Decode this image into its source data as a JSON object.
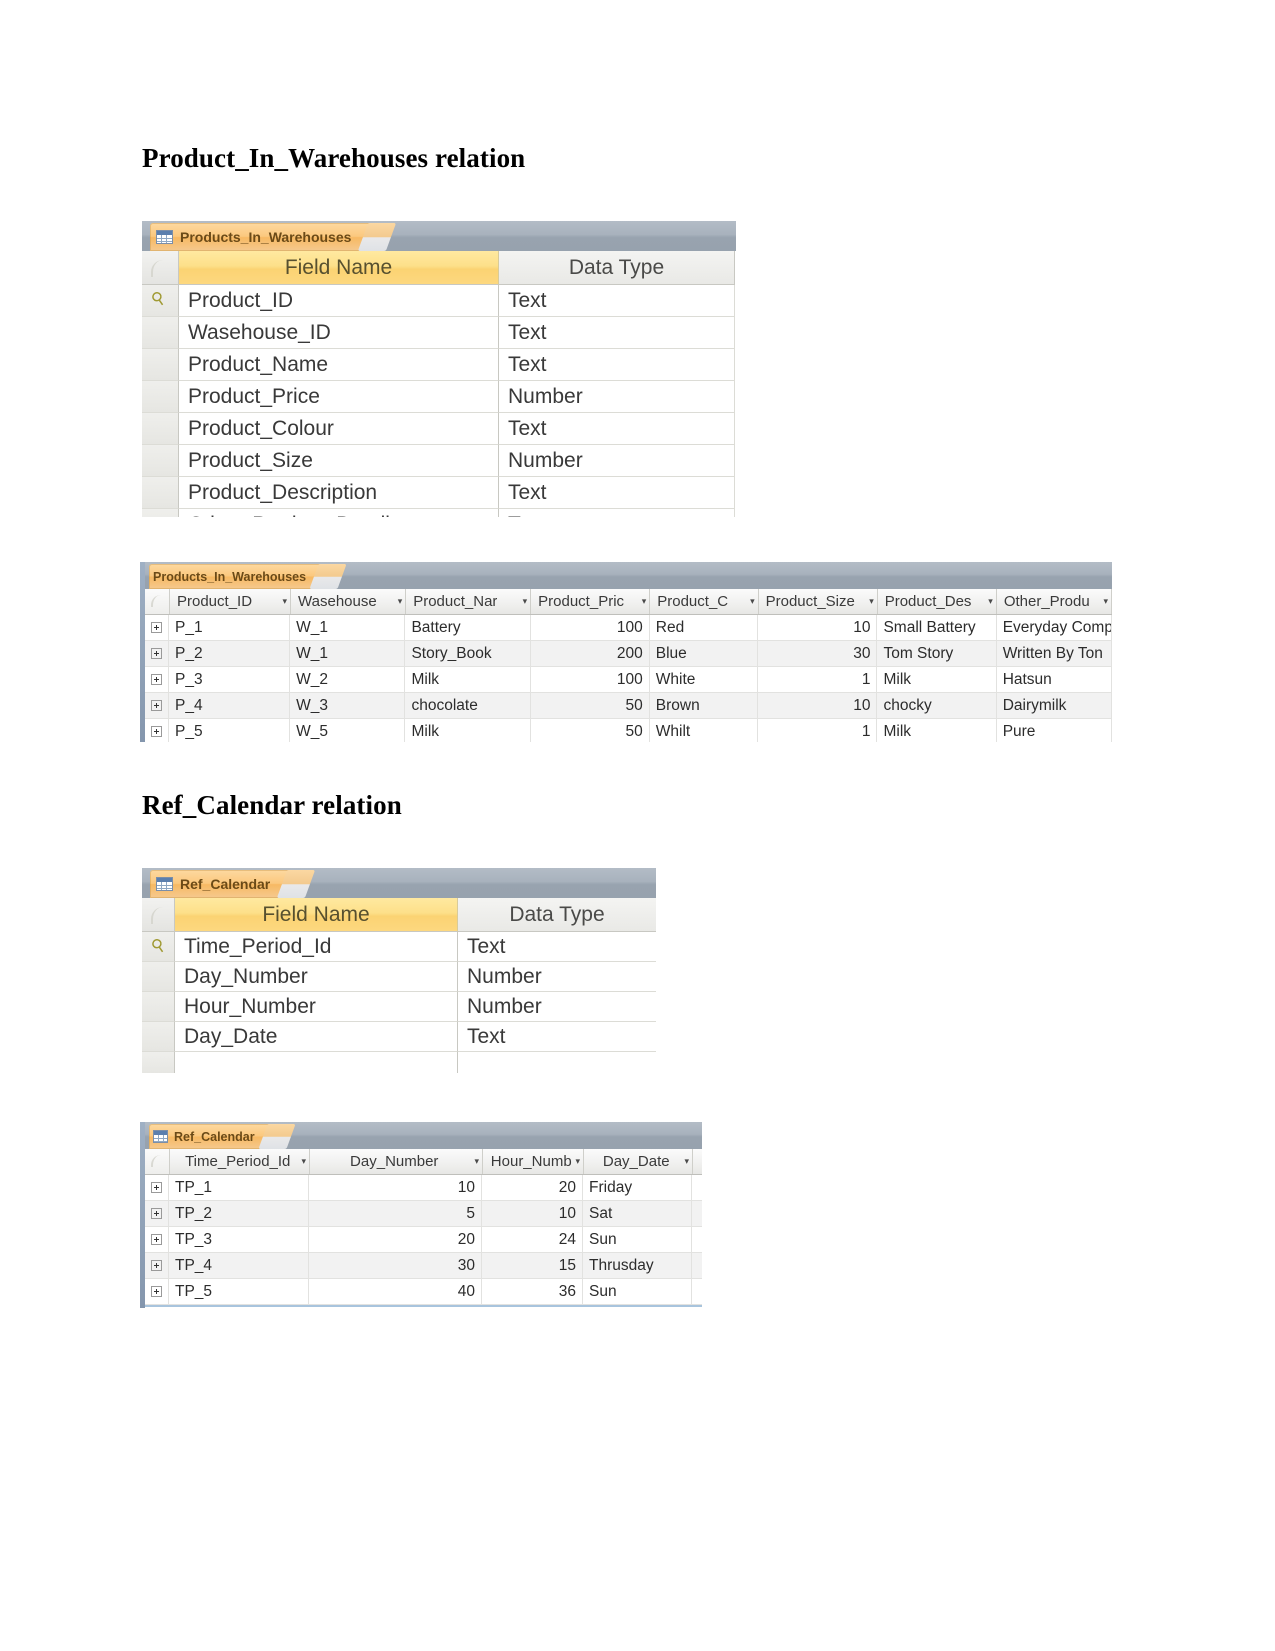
{
  "document": {
    "headings": [
      {
        "id": "products-heading",
        "text": "Product_In_Warehouses relation"
      },
      {
        "id": "calendar-heading",
        "text": "Ref_Calendar relation"
      }
    ]
  },
  "products_design": {
    "tab_label": "Products_In_Warehouses",
    "columns": {
      "field_name": "Field Name",
      "data_type": "Data Type"
    },
    "rows": [
      {
        "primary_key": true,
        "field": "Product_ID",
        "type": "Text"
      },
      {
        "primary_key": false,
        "field": "Wasehouse_ID",
        "type": "Text"
      },
      {
        "primary_key": false,
        "field": "Product_Name",
        "type": "Text"
      },
      {
        "primary_key": false,
        "field": "Product_Price",
        "type": "Number"
      },
      {
        "primary_key": false,
        "field": "Product_Colour",
        "type": "Text"
      },
      {
        "primary_key": false,
        "field": "Product_Size",
        "type": "Number"
      },
      {
        "primary_key": false,
        "field": "Product_Description",
        "type": "Text"
      },
      {
        "primary_key": false,
        "field": "Other_Product_Details",
        "type": "Text"
      }
    ]
  },
  "products_datasheet": {
    "tab_label": "Products_In_Warehouses",
    "columns": [
      {
        "label": "Product_ID",
        "align": "left",
        "caret": "▾"
      },
      {
        "label": "Wasehouse",
        "align": "left",
        "caret": "▾"
      },
      {
        "label": "Product_Nar",
        "align": "left",
        "caret": "▾"
      },
      {
        "label": "Product_Pric",
        "align": "left",
        "caret": "▾"
      },
      {
        "label": "Product_C",
        "align": "left",
        "caret": "▾"
      },
      {
        "label": "Product_Size",
        "align": "left",
        "caret": "▾"
      },
      {
        "label": "Product_Des",
        "align": "left",
        "caret": "▾"
      },
      {
        "label": "Other_Produ",
        "align": "left",
        "caret": "▾"
      }
    ],
    "rows": [
      {
        "product_id": "P_1",
        "warehouse": "W_1",
        "name": "Battery",
        "price": "100",
        "colour": "Red",
        "size": "10",
        "description": "Small Battery",
        "other": "Everyday Comp"
      },
      {
        "product_id": "P_2",
        "warehouse": "W_1",
        "name": "Story_Book",
        "price": "200",
        "colour": "Blue",
        "size": "30",
        "description": "Tom Story",
        "other": "Written By Ton"
      },
      {
        "product_id": "P_3",
        "warehouse": "W_2",
        "name": "Milk",
        "price": "100",
        "colour": "White",
        "size": "1",
        "description": "Milk",
        "other": "Hatsun"
      },
      {
        "product_id": "P_4",
        "warehouse": "W_3",
        "name": "chocolate",
        "price": "50",
        "colour": "Brown",
        "size": "10",
        "description": "chocky",
        "other": "Dairymilk"
      },
      {
        "product_id": "P_5",
        "warehouse": "W_5",
        "name": "Milk",
        "price": "50",
        "colour": "Whilt",
        "size": "1",
        "description": "Milk",
        "other": "Pure"
      }
    ]
  },
  "calendar_design": {
    "tab_label": "Ref_Calendar",
    "columns": {
      "field_name": "Field Name",
      "data_type": "Data Type"
    },
    "rows": [
      {
        "primary_key": true,
        "field": "Time_Period_Id",
        "type": "Text"
      },
      {
        "primary_key": false,
        "field": "Day_Number",
        "type": "Number"
      },
      {
        "primary_key": false,
        "field": "Hour_Number",
        "type": "Number"
      },
      {
        "primary_key": false,
        "field": "Day_Date",
        "type": "Text"
      }
    ]
  },
  "calendar_datasheet": {
    "tab_label": "Ref_Calendar",
    "columns": [
      {
        "label": "Time_Period_Id",
        "align": "center",
        "caret": "▾"
      },
      {
        "label": "Day_Number",
        "align": "center",
        "caret": "▾"
      },
      {
        "label": "Hour_Numb",
        "align": "center",
        "caret": "▾"
      },
      {
        "label": "Day_Date",
        "align": "center",
        "caret": "▾"
      }
    ],
    "rows": [
      {
        "time_period_id": "TP_1",
        "day_number": "10",
        "hour_number": "20",
        "day_date": "Friday"
      },
      {
        "time_period_id": "TP_2",
        "day_number": "5",
        "hour_number": "10",
        "day_date": "Sat"
      },
      {
        "time_period_id": "TP_3",
        "day_number": "20",
        "hour_number": "24",
        "day_date": "Sun"
      },
      {
        "time_period_id": "TP_4",
        "day_number": "30",
        "hour_number": "15",
        "day_date": "Thrusday"
      },
      {
        "time_period_id": "TP_5",
        "day_number": "40",
        "hour_number": "36",
        "day_date": "Sun"
      }
    ]
  },
  "colors": {
    "tab_orange": "#f7b963",
    "field_name_yellow": "#fbd373",
    "tab_strip_gray": "#98a3af",
    "alt_row": "#f2f2f2"
  }
}
